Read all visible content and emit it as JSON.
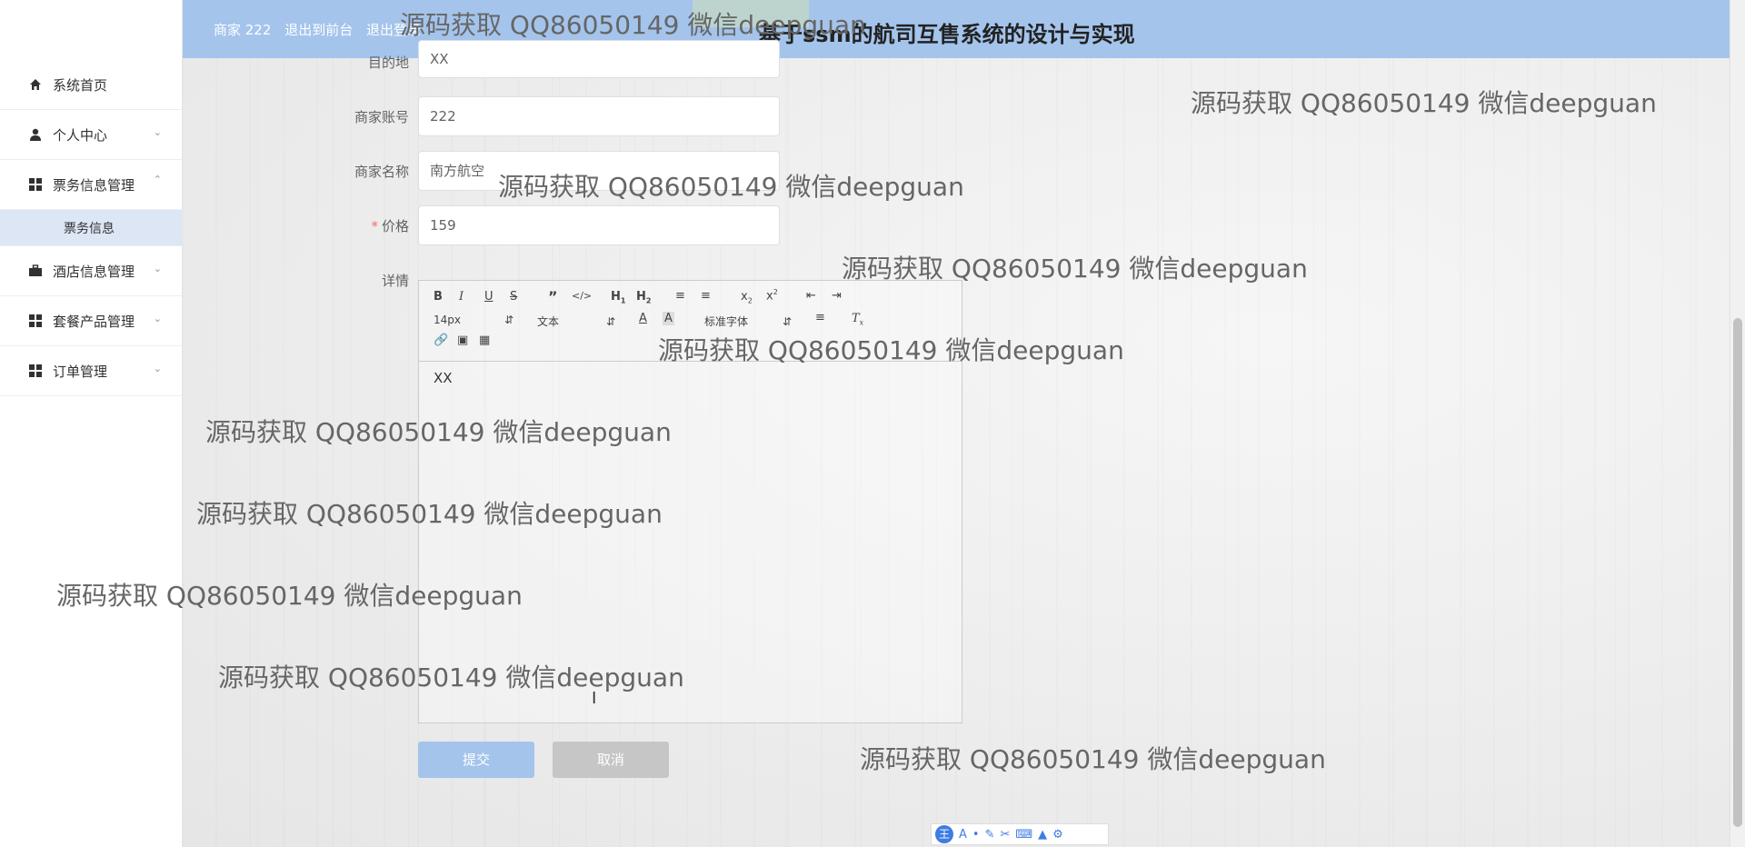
{
  "header": {
    "user_label": "商家 222",
    "back_link": "退出到前台",
    "logout_link": "退出登录",
    "title": "基于ssm的航司互售系统的设计与实现"
  },
  "sidebar": {
    "items": [
      {
        "label": "系统首页",
        "icon": "home-icon"
      },
      {
        "label": "个人中心",
        "icon": "user-icon"
      },
      {
        "label": "票务信息管理",
        "icon": "grid-icon"
      },
      {
        "label": "酒店信息管理",
        "icon": "briefcase-icon"
      },
      {
        "label": "套餐产品管理",
        "icon": "grid-icon"
      },
      {
        "label": "订单管理",
        "icon": "grid-icon"
      }
    ],
    "submenu": {
      "label": "票务信息"
    }
  },
  "form": {
    "destination": {
      "label": "目的地",
      "value": "XX"
    },
    "merchant_account": {
      "label": "商家账号",
      "value": "222"
    },
    "merchant_name": {
      "label": "商家名称",
      "value": "南方航空"
    },
    "price": {
      "label": "价格",
      "value": "159"
    },
    "details": {
      "label": "详情",
      "value": "XX"
    }
  },
  "editor": {
    "font_size": "14px",
    "text_type": "文本",
    "font_family": "标准字体"
  },
  "buttons": {
    "submit": "提交",
    "cancel": "取消"
  },
  "watermark": "源码获取 QQ86050149 微信deepguan",
  "colors": {
    "header_bg": "#a4c4ec",
    "submit_bg": "#a4c4ec",
    "cancel_bg": "#c6c6c6",
    "submenu_bg": "#dce6f4"
  }
}
